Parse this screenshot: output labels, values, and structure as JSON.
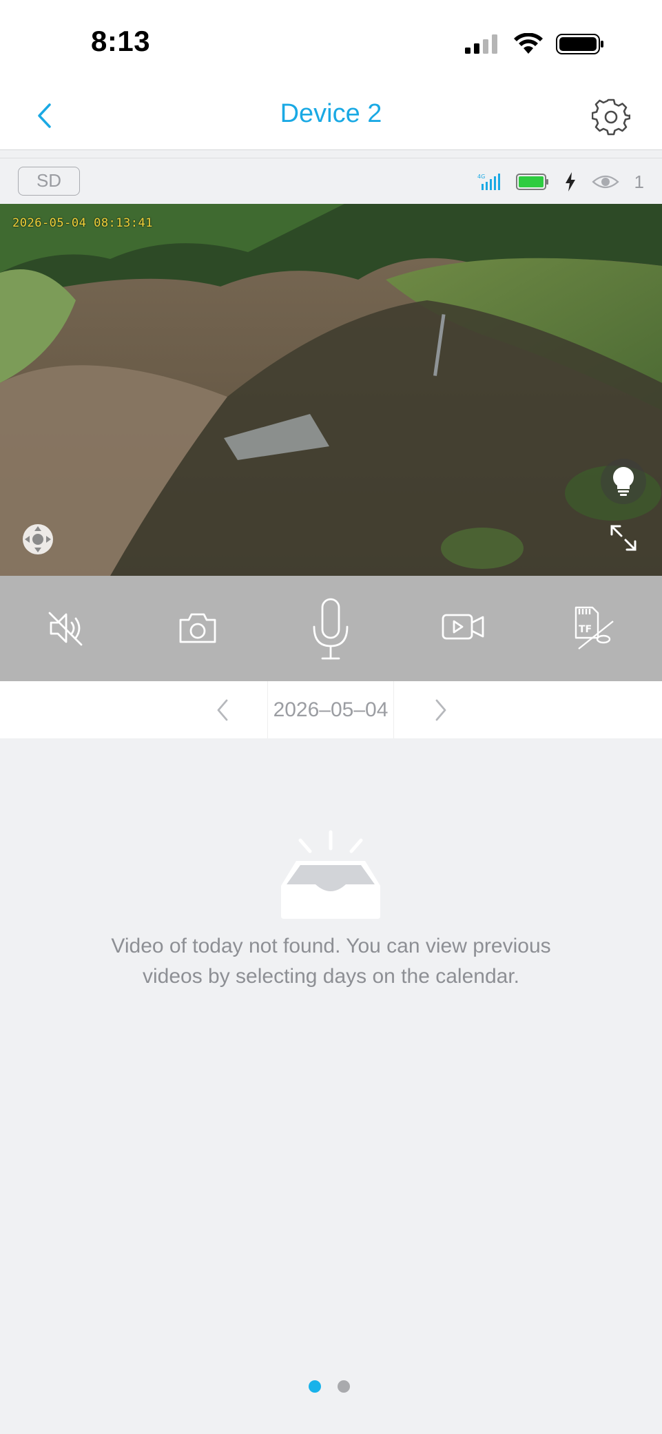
{
  "status_bar": {
    "time": "8:13"
  },
  "nav": {
    "title": "Device 2"
  },
  "info_strip": {
    "sd_label": "SD",
    "viewer_count": "1"
  },
  "video": {
    "timestamp": "2026-05-04 08:13:41"
  },
  "controls": {
    "items": [
      "mute-speaker-icon",
      "snapshot-camera-icon",
      "microphone-icon",
      "record-video-icon",
      "tf-card-disabled-icon"
    ]
  },
  "date_bar": {
    "date": "2026–05–04"
  },
  "empty_state": {
    "line1": "Video of today not found. You can view previous",
    "line2": "videos by selecting days on the calendar."
  },
  "pager": {
    "pages": 2,
    "active_index": 0
  },
  "colors": {
    "accent": "#1aa9e4",
    "battery": "#2ecc40",
    "pager_active": "#19b2ea",
    "control_bar": "#b4b4b4"
  }
}
